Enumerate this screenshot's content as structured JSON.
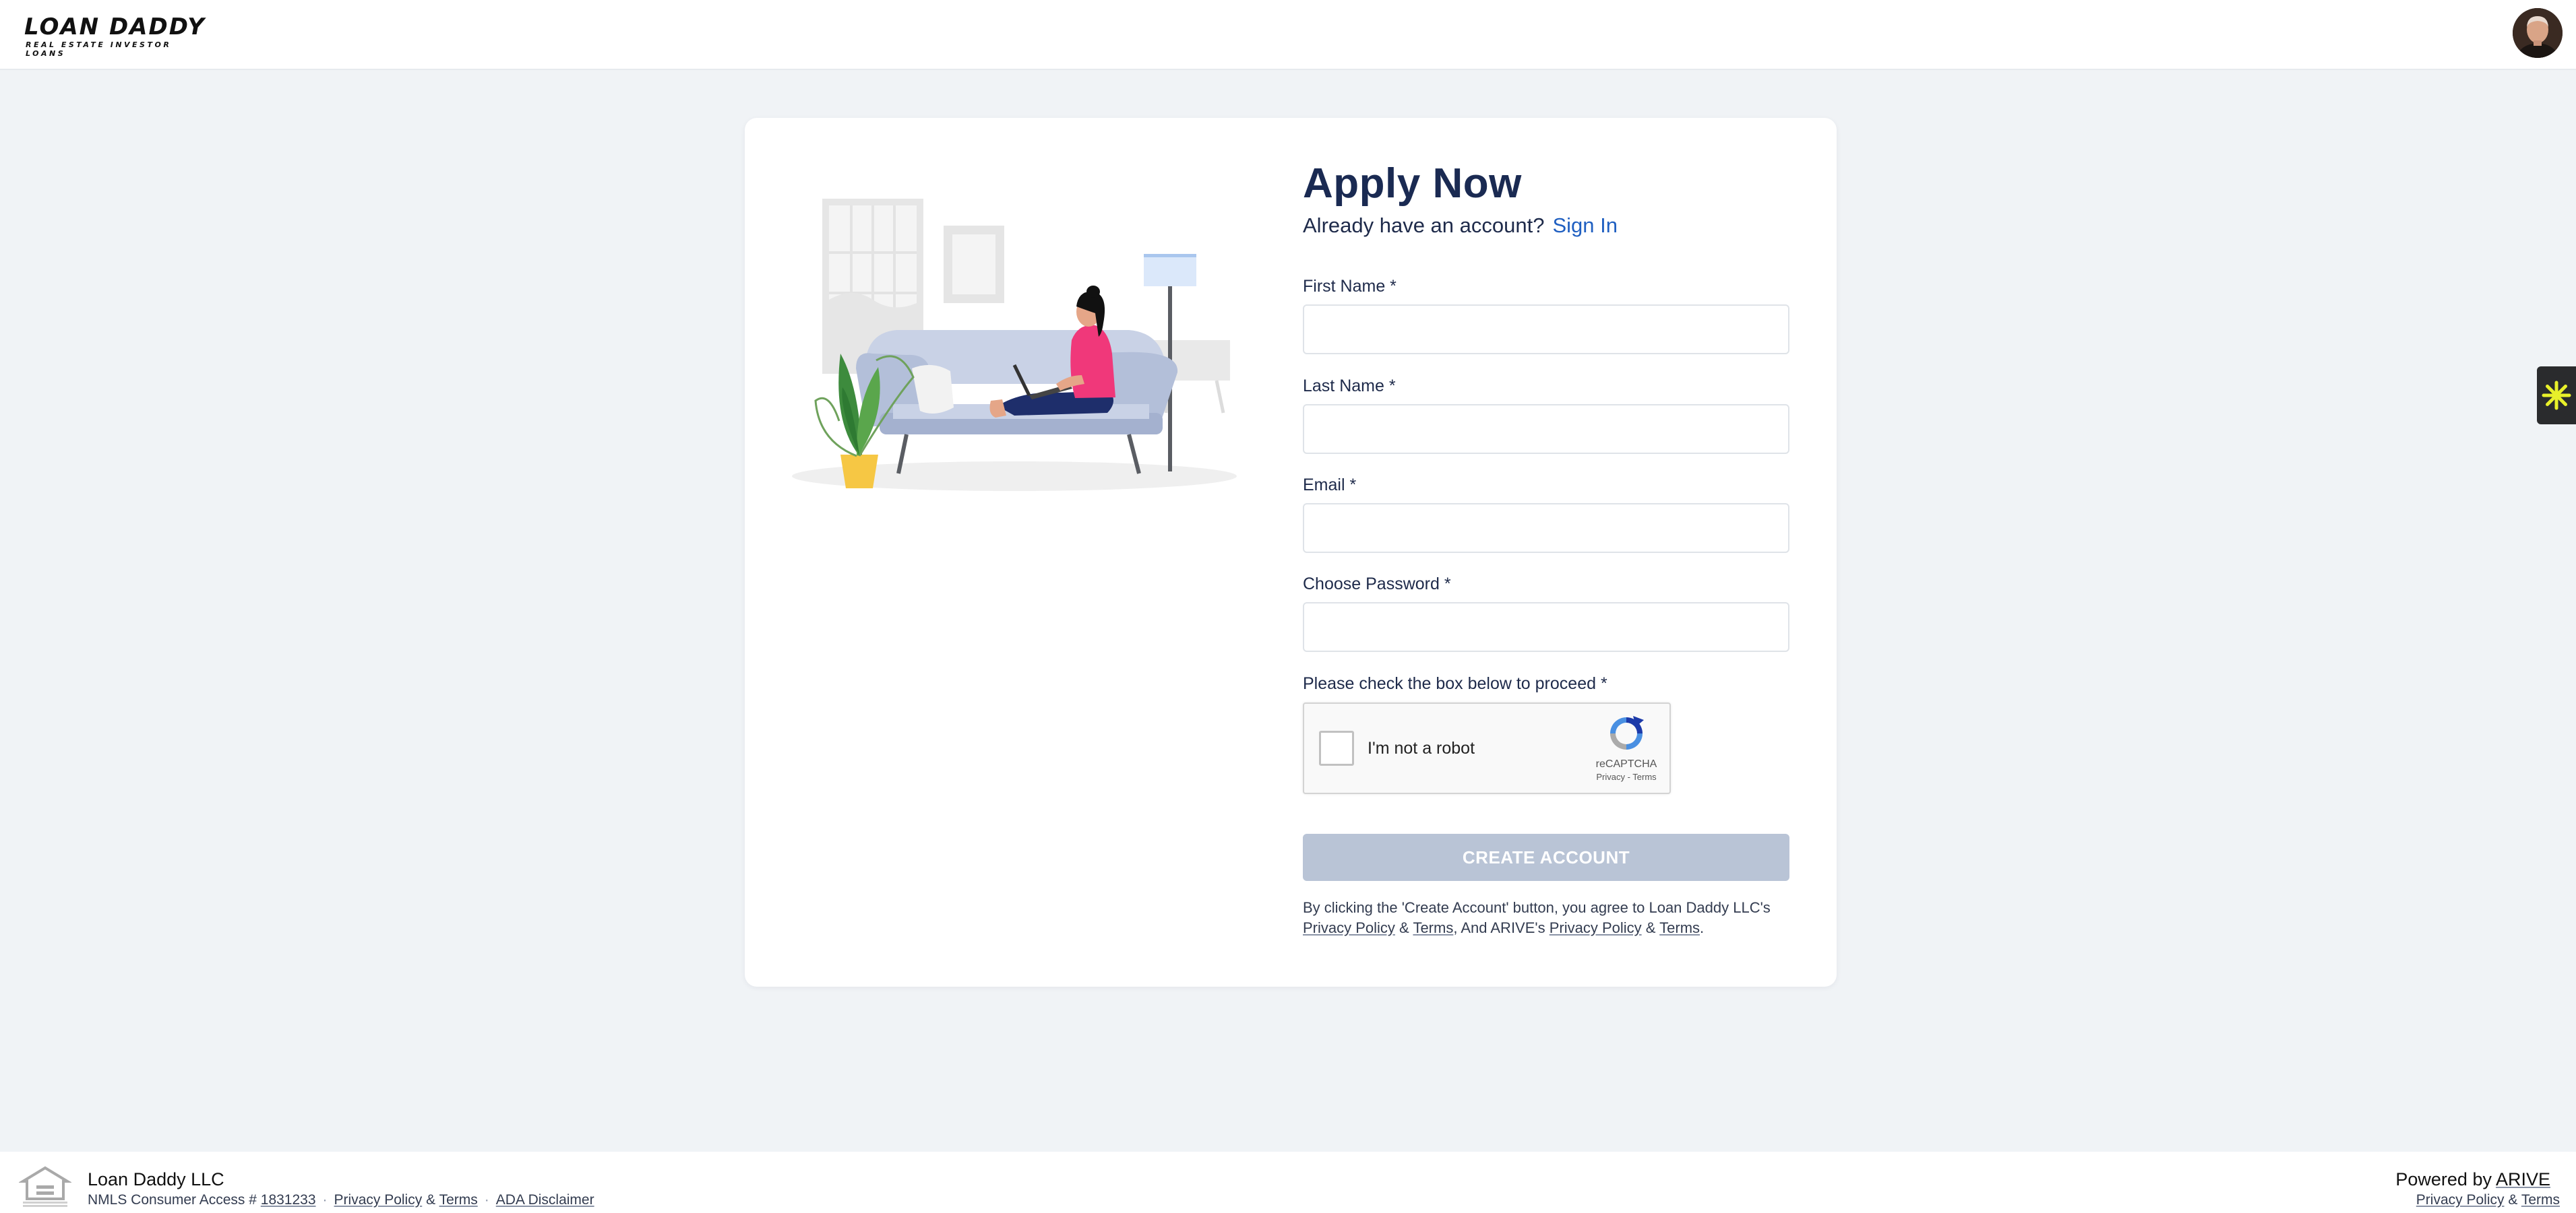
{
  "header": {
    "logo_main": "LOAN DADDY",
    "logo_sub": "REAL ESTATE INVESTOR LOANS"
  },
  "form": {
    "title": "Apply Now",
    "subtitle": "Already have an account?",
    "sign_in": "Sign In",
    "first_name_label": "First Name *",
    "first_name_value": "",
    "last_name_label": "Last Name *",
    "last_name_value": "",
    "email_label": "Email *",
    "email_value": "",
    "password_label": "Choose Password *",
    "password_value": "",
    "captcha_label": "Please check the box below to proceed *",
    "captcha_text": "I'm not a robot",
    "captcha_brand": "reCAPTCHA",
    "captcha_privacy": "Privacy",
    "captcha_sep": " - ",
    "captcha_terms": "Terms",
    "create_button": "CREATE ACCOUNT",
    "disclaimer": {
      "prefix": "By clicking the 'Create Account' button, you agree to Loan Daddy LLC's ",
      "privacy1": "Privacy Policy",
      "amp1": " & ",
      "terms1": "Terms",
      "middle": ", And ARIVE's ",
      "privacy2": "Privacy Policy",
      "amp2": " & ",
      "terms2": "Terms",
      "end": "."
    }
  },
  "footer": {
    "company": "Loan Daddy LLC",
    "nmls_prefix": "NMLS Consumer Access # ",
    "nmls_number": "1831233",
    "sep": "·",
    "privacy": "Privacy Policy",
    "amp": "&",
    "terms": "Terms",
    "ada": "ADA Disclaimer",
    "powered_prefix": "Powered by ",
    "powered_brand": "ARIVE",
    "right_privacy": "Privacy Policy",
    "right_amp": "&",
    "right_terms": "Terms"
  },
  "colors": {
    "background": "#f0f3f6",
    "primary_text": "#1a2a52",
    "link": "#1f5fc1",
    "button_disabled": "#b9c4d6",
    "accent_pink": "#f0387a"
  },
  "icons": [
    "avatar",
    "zap-widget-icon",
    "recaptcha-icon",
    "equal-housing-opportunity-icon"
  ]
}
